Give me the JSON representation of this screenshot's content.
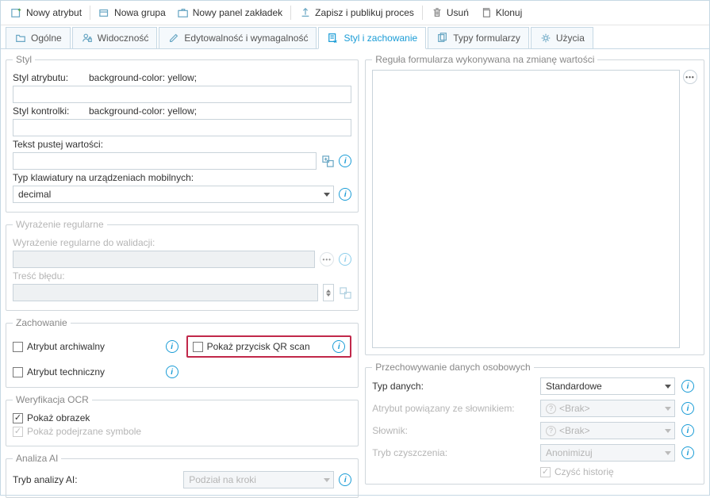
{
  "toolbar": {
    "newAttr": "Nowy atrybut",
    "newGroup": "Nowa grupa",
    "newPanel": "Nowy panel zakładek",
    "savePublish": "Zapisz i publikuj proces",
    "delete": "Usuń",
    "clone": "Klonuj"
  },
  "tabs": {
    "general": "Ogólne",
    "visibility": "Widoczność",
    "edit": "Edytowalność i wymagalność",
    "style": "Styl i zachowanie",
    "formTypes": "Typy formularzy",
    "usage": "Użycia"
  },
  "style": {
    "legend": "Styl",
    "attrStyleLbl": "Styl atrybutu:",
    "attrStyleVal": "background-color: yellow;",
    "ctrlStyleLbl": "Styl kontrolki:",
    "ctrlStyleVal": "background-color: yellow;",
    "emptyTextLbl": "Tekst pustej wartości:",
    "kbTypeLbl": "Typ klawiatury na urządzeniach mobilnych:",
    "kbTypeVal": "decimal"
  },
  "regex": {
    "legend": "Wyrażenie regularne",
    "regexLbl": "Wyrażenie regularne do walidacji:",
    "errLbl": "Treść błędu:"
  },
  "behavior": {
    "legend": "Zachowanie",
    "archive": "Atrybut archiwalny",
    "qr": "Pokaż przycisk QR scan",
    "technical": "Atrybut techniczny"
  },
  "ocr": {
    "legend": "Weryfikacja OCR",
    "showImg": "Pokaż obrazek",
    "suspect": "Pokaż podejrzane symbole"
  },
  "ai": {
    "legend": "Analiza AI",
    "modeLbl": "Tryb analizy AI:",
    "modeVal": "Podział na kroki"
  },
  "formula": {
    "legend": "Reguła formularza wykonywana na zmianę wartości"
  },
  "storage": {
    "legend": "Przechowywanie danych osobowych",
    "typeLbl": "Typ danych:",
    "typeVal": "Standardowe",
    "dictAttrLbl": "Atrybut powiązany ze słownikiem:",
    "dictLbl": "Słownik:",
    "brak": "<Brak>",
    "cleanLbl": "Tryb czyszczenia:",
    "cleanVal": "Anonimizuj",
    "history": "Czyść historię"
  }
}
